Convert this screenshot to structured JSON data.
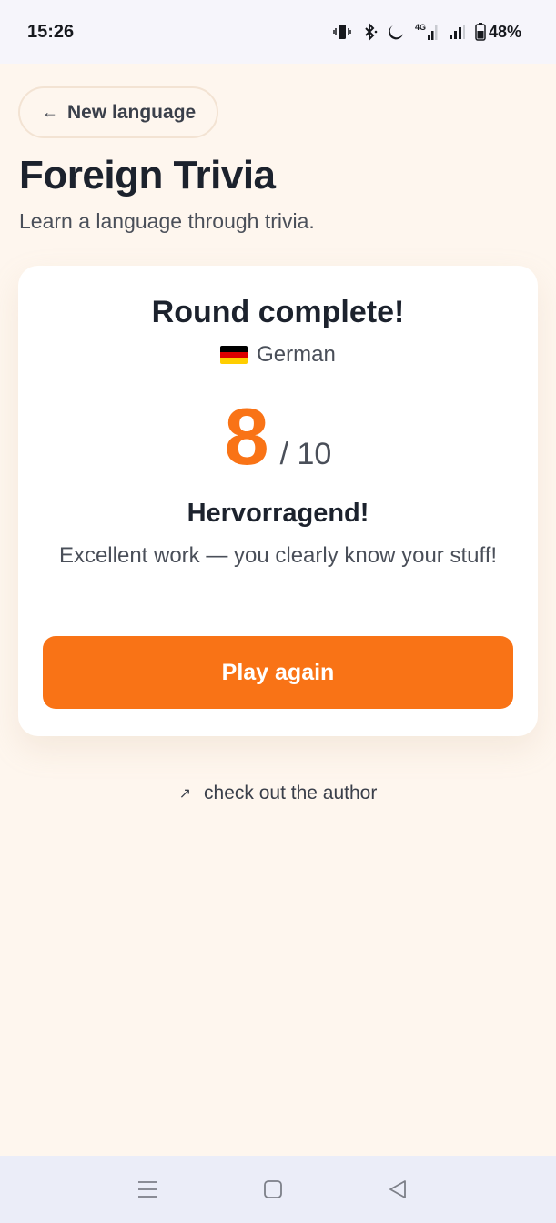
{
  "status_bar": {
    "time": "15:26",
    "battery_percent": "48%",
    "icons": [
      "vibrate-icon",
      "bluetooth-icon",
      "moon-icon",
      "signal-4g-icon",
      "signal-icon",
      "battery-icon"
    ]
  },
  "header": {
    "back_label": "New language",
    "back_arrow": "←",
    "title": "Foreign Trivia",
    "subtitle": "Learn a language through trivia."
  },
  "result": {
    "title": "Round complete!",
    "language": "German",
    "flag_colors": [
      "#000000",
      "#dd0000",
      "#ffce00"
    ],
    "score": "8",
    "total": "/ 10",
    "rating_title": "Hervorragend!",
    "rating_message": "Excellent work — you clearly know your stuff!",
    "play_again_label": "Play again"
  },
  "footer": {
    "author_arrow": "↗",
    "author_link": "check out the author"
  },
  "colors": {
    "accent": "#f97316",
    "background": "#fef6ee",
    "card": "#ffffff",
    "text": "#1c222d"
  },
  "nav_bar": {
    "icons": [
      "menu-icon",
      "home-square-icon",
      "back-triangle-icon"
    ]
  }
}
